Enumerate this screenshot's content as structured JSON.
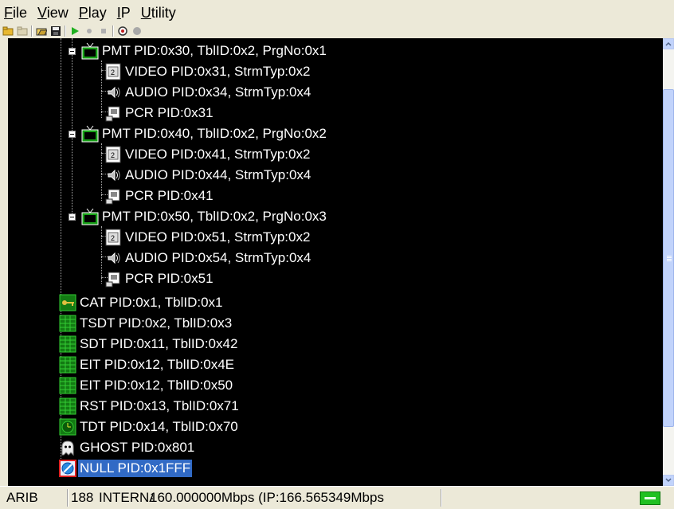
{
  "menu": [
    "File",
    "View",
    "Play",
    "IP",
    "Utility"
  ],
  "toolbar": {
    "buttons": [
      {
        "name": "new-folder-icon",
        "color": "#d4a020"
      },
      {
        "name": "open-folder-icon",
        "color": "#c8c0a0"
      },
      {
        "name": "open-icon",
        "color": "#303030"
      },
      {
        "name": "save-icon",
        "color": "#303030"
      },
      {
        "name": "play-icon",
        "color": "#20b020"
      },
      {
        "name": "record-icon",
        "color": "#b0b0b0"
      },
      {
        "name": "stop-icon",
        "color": "#b0b0b0"
      },
      {
        "name": "target-icon",
        "color": "#303030"
      },
      {
        "name": "circle-icon",
        "color": "#a0a0a0"
      }
    ]
  },
  "tree": {
    "nodes": [
      {
        "label": "PMT PID:0x30, TblID:0x2, PrgNo:0x1",
        "icon": "tv-icon"
      },
      {
        "label": "VIDEO PID:0x31, StrmTyp:0x2",
        "icon": "film-icon"
      },
      {
        "label": "AUDIO PID:0x34, StrmTyp:0x4",
        "icon": "speaker-icon"
      },
      {
        "label": "PCR PID:0x31",
        "icon": "clock-box-icon"
      },
      {
        "label": "PMT PID:0x40, TblID:0x2, PrgNo:0x2",
        "icon": "tv-icon"
      },
      {
        "label": "VIDEO PID:0x41, StrmTyp:0x2",
        "icon": "film-icon"
      },
      {
        "label": "AUDIO PID:0x44, StrmTyp:0x4",
        "icon": "speaker-icon"
      },
      {
        "label": "PCR PID:0x41",
        "icon": "clock-box-icon"
      },
      {
        "label": "PMT PID:0x50, TblID:0x2, PrgNo:0x3",
        "icon": "tv-icon"
      },
      {
        "label": "VIDEO PID:0x51, StrmTyp:0x2",
        "icon": "film-icon"
      },
      {
        "label": "AUDIO PID:0x54, StrmTyp:0x4",
        "icon": "speaker-icon"
      },
      {
        "label": "PCR PID:0x51",
        "icon": "clock-box-icon"
      },
      {
        "label": "CAT PID:0x1, TblID:0x1",
        "icon": "key-table-icon"
      },
      {
        "label": "TSDT PID:0x2, TblID:0x3",
        "icon": "table-icon"
      },
      {
        "label": "SDT PID:0x11, TblID:0x42",
        "icon": "table-icon"
      },
      {
        "label": "EIT PID:0x12, TblID:0x4E",
        "icon": "table-icon"
      },
      {
        "label": "EIT PID:0x12, TblID:0x50",
        "icon": "table-icon"
      },
      {
        "label": "RST PID:0x13, TblID:0x71",
        "icon": "table-icon"
      },
      {
        "label": "TDT PID:0x14, TblID:0x70",
        "icon": "time-table-icon"
      },
      {
        "label": "GHOST PID:0x801",
        "icon": "ghost-icon"
      },
      {
        "label": "NULL PID:0x1FFF",
        "icon": "null-icon",
        "selected": true
      }
    ]
  },
  "status": {
    "standard": "ARIB",
    "packet": "188",
    "source": "INTERNA",
    "bitrate": "160.000000Mbps (IP:166.565349Mbps"
  },
  "colors": {
    "tree_background": "#000000",
    "selection": "#316ac5",
    "status_led": "#21c021"
  }
}
